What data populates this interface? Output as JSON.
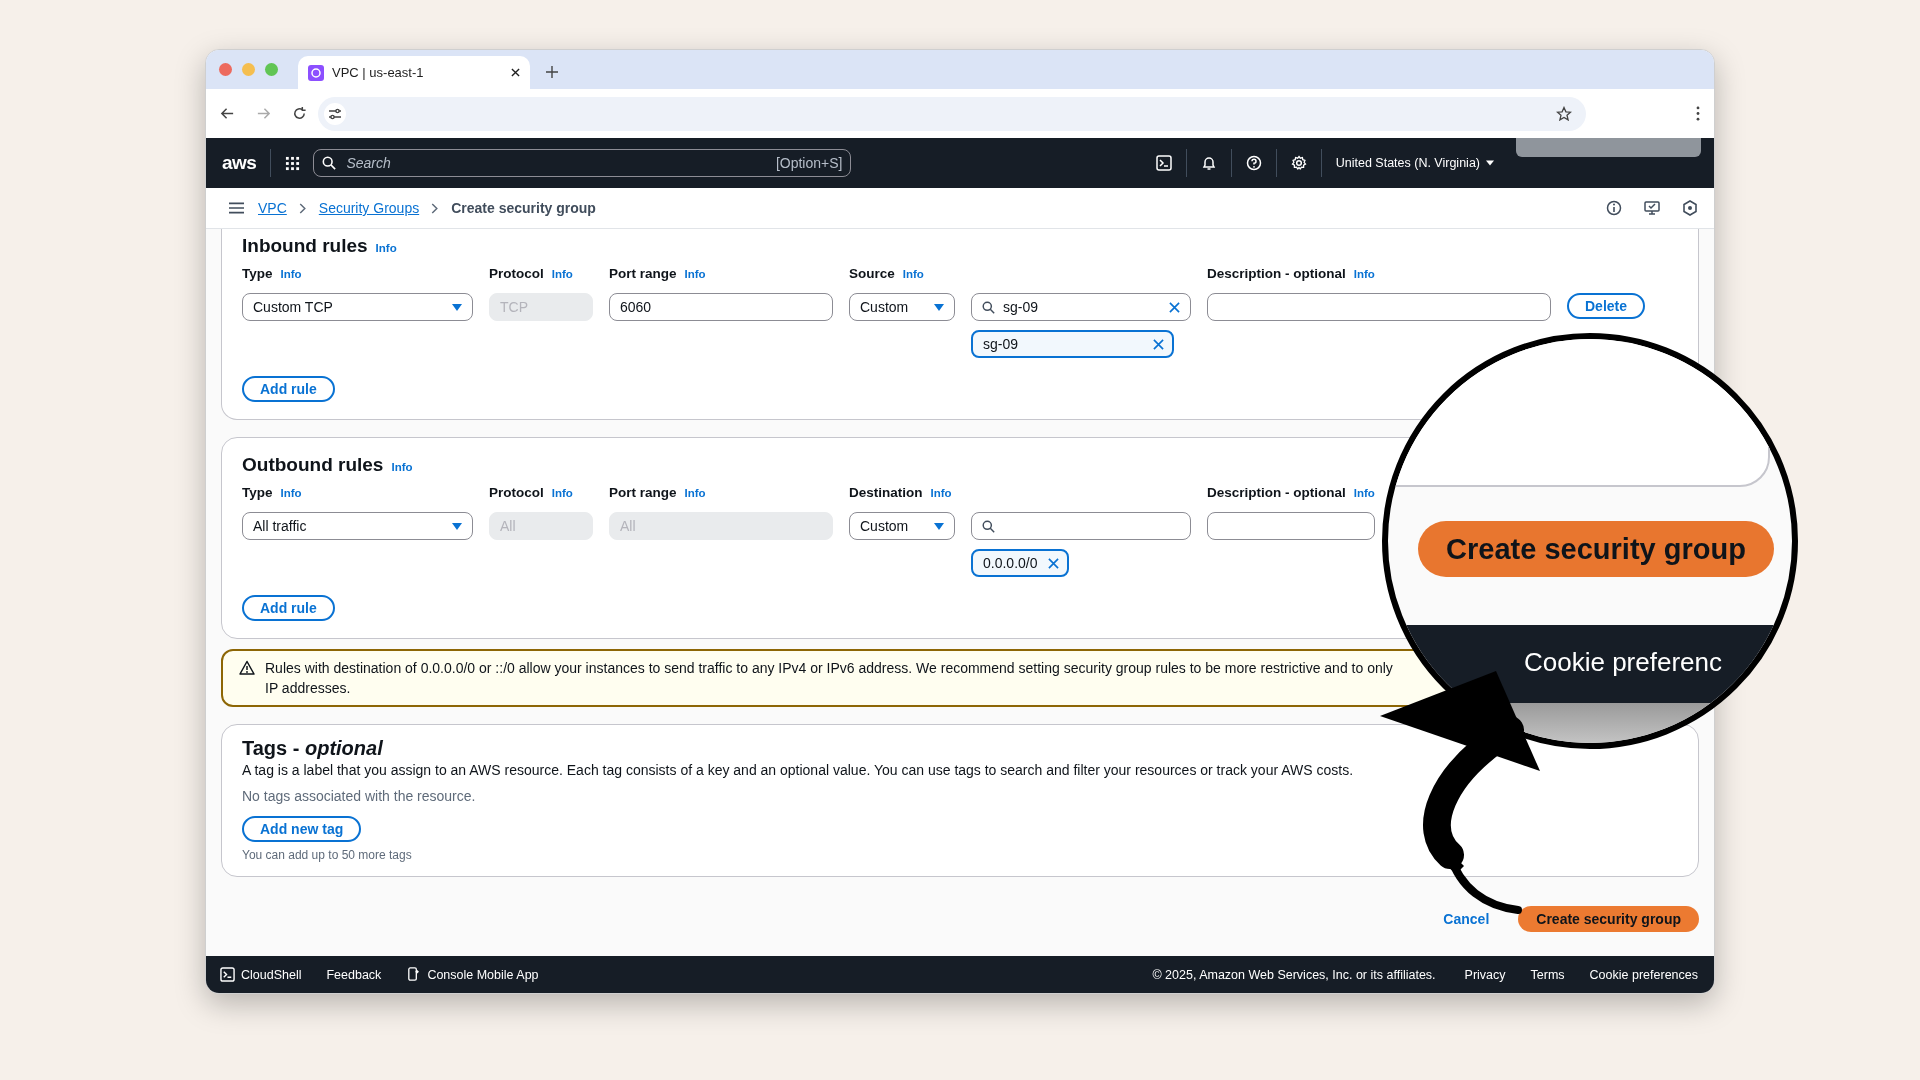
{
  "browser": {
    "tab_title": "VPC | us-east-1"
  },
  "console_nav": {
    "logo": "aws",
    "search_placeholder": "Search",
    "search_shortcut": "[Option+S]",
    "region": "United States (N. Virginia)"
  },
  "breadcrumbs": [
    {
      "label": "VPC",
      "current": false
    },
    {
      "label": "Security Groups",
      "current": false
    },
    {
      "label": "Create security group",
      "current": true
    }
  ],
  "sections": [
    {
      "title": "Inbound rules",
      "info": "Info",
      "columns": [
        {
          "label": "Type",
          "info": "Info"
        },
        {
          "label": "Protocol",
          "info": "Info"
        },
        {
          "label": "Port range",
          "info": "Info"
        },
        {
          "label": "Source",
          "info": "Info"
        },
        {
          "label": "Description - optional",
          "info": "Info"
        }
      ],
      "rule": {
        "type": "Custom TCP",
        "protocol": {
          "value": "TCP",
          "disabled": true
        },
        "port_range": {
          "value": "6060",
          "disabled": false
        },
        "target": "Custom",
        "search_value": "sg-09",
        "chip": "sg-09",
        "delete": "Delete"
      },
      "add_rule": "Add rule"
    },
    {
      "title": "Outbound rules",
      "info": "Info",
      "columns": [
        {
          "label": "Type",
          "info": "Info"
        },
        {
          "label": "Protocol",
          "info": "Info"
        },
        {
          "label": "Port range",
          "info": "Info"
        },
        {
          "label": "Destination",
          "info": "Info"
        },
        {
          "label": "Description - optional",
          "info": "Info"
        }
      ],
      "rule": {
        "type": "All traffic",
        "protocol": {
          "value": "All",
          "disabled": true
        },
        "port_range": {
          "value": "All",
          "disabled": true
        },
        "target": "Custom",
        "chip": "0.0.0.0/0"
      },
      "add_rule": "Add rule"
    }
  ],
  "warning": {
    "lines": [
      "Rules with destination of 0.0.0.0/0 or ::/0 allow your instances to send traffic to any IPv4 or IPv6 address. We recommend setting security group rules to be more restrictive and to only",
      "IP addresses."
    ]
  },
  "tags": {
    "title": "Tags - *optional*",
    "description": "A tag is a label that you assign to an AWS resource. Each tag consists of a key and an optional value. You can use tags to search and filter your resources or track your AWS costs.",
    "empty_text": "No tags associated with the resource.",
    "add_button": "Add new tag",
    "hint": "You can add up to 50 more tags"
  },
  "actions": {
    "cancel": "Cancel",
    "submit": "Create security group"
  },
  "footer": {
    "left": [
      "CloudShell",
      "Feedback",
      "Console Mobile App"
    ],
    "copyright": "© 2025, Amazon Web Services, Inc. or its affiliates.",
    "right": [
      "Privacy",
      "Terms",
      "Cookie preferences"
    ]
  },
  "magnifier": {
    "button": "Create security group",
    "footer_text": "Cookie preferenc"
  }
}
